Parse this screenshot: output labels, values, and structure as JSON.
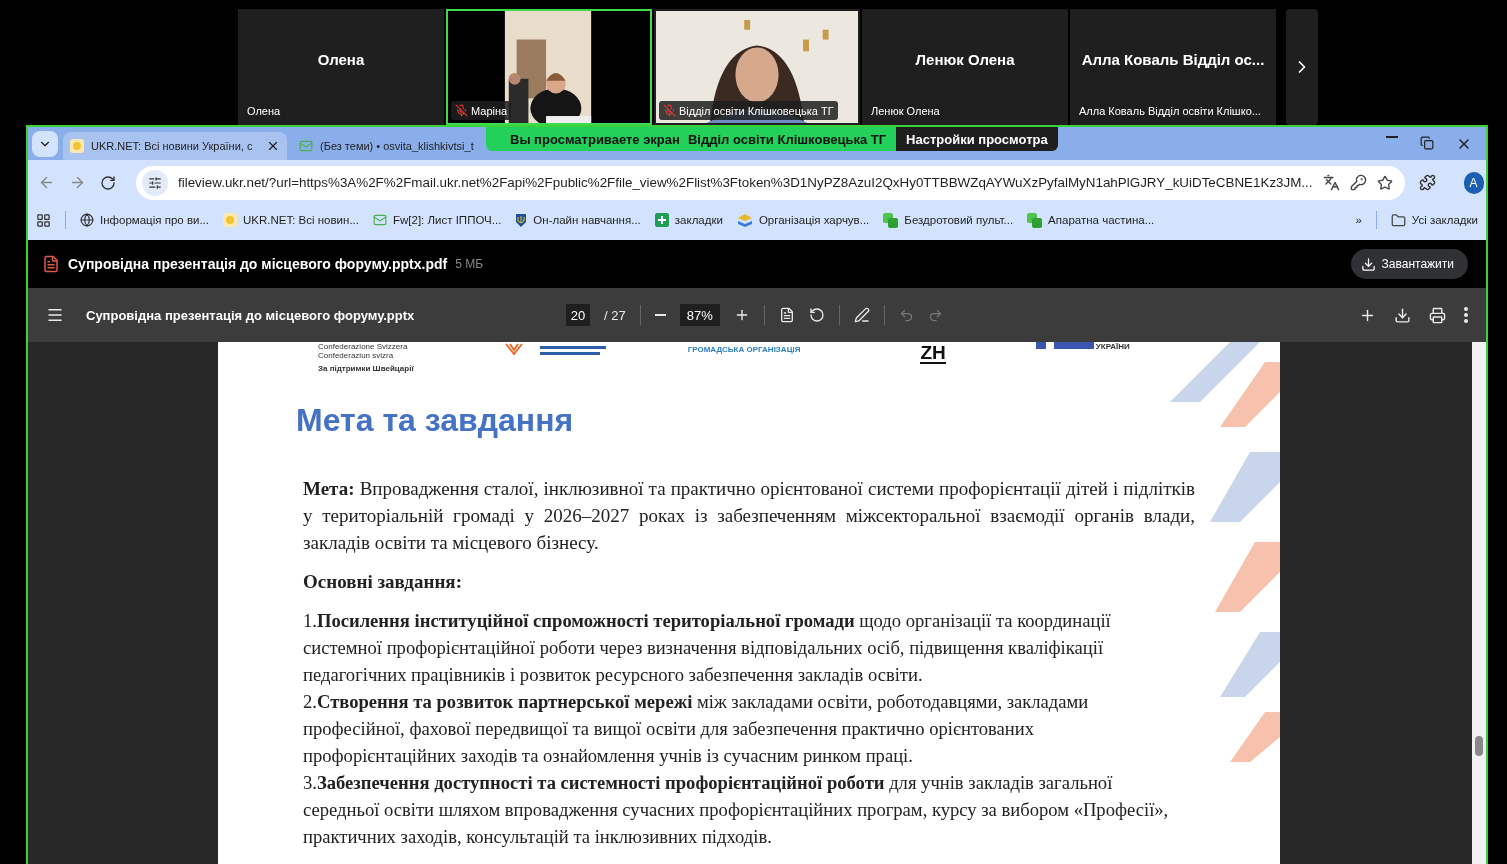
{
  "participants": [
    {
      "kind": "name",
      "name": "Олена",
      "label": "Олена",
      "muted": false,
      "selected": false
    },
    {
      "kind": "video",
      "label": "Маріна",
      "muted": true,
      "selected": true
    },
    {
      "kind": "video",
      "label": "Відділ освіти Клішковецька ТГ",
      "muted": true,
      "selected": false
    },
    {
      "kind": "name",
      "name": "Ленюк Олена",
      "label": "Ленюк Олена",
      "muted": false,
      "selected": false
    },
    {
      "kind": "name",
      "name": "Алла Коваль Відділ ос...",
      "label": "Алла Коваль Відділ освіти Клішко...",
      "muted": false,
      "selected": false
    }
  ],
  "share_banner": {
    "text": "Вы просматриваете экран",
    "presenter": "Відділ освіти Клішковецька ТГ",
    "settings": "Настройки просмотра"
  },
  "tabs": [
    {
      "title": "UKR.NET: Всі новини України, с",
      "selected": false,
      "closable": true
    },
    {
      "title": "(Без теми) • osvita_klishkivtsi_t",
      "selected": false,
      "closable": false
    }
  ],
  "address": "fileview.ukr.net/?url=https%3A%2F%2Fmail.ukr.net%2Fapi%2Fpublic%2Ffile_view%2Flist%3Ftoken%3D1NyPZ8AzuI2QxHy0TTBBWZqAYWuXzPyfalMyN1ahPlGJRY_kUiDTeCBNE1Kz3JM...",
  "profile": "A",
  "bookmarks": [
    "Інформація про ви...",
    "UKR.NET: Всі новин...",
    "Fw[2]: Лист ІППОЧ...",
    "Он-лайн навчання...",
    "закладки",
    "Організація харчув...",
    "Бездротовий пульт...",
    "Апаратна частина..."
  ],
  "bookmarks_more": "»",
  "all_bookmarks": "Усі закладки",
  "file_header": {
    "name": "Супровідна презентація до місцевого форуму.pptx.pdf",
    "size": "5 МБ",
    "download": "Завантажити"
  },
  "pdf_toolbar": {
    "title": "Супровідна презентація до місцевого форуму.pptx",
    "page": "20",
    "pages": "/ 27",
    "zoom": "87%"
  },
  "slide": {
    "logos": {
      "swiss_1": "Confederazione Svizzera",
      "swiss_2": "Confederaziun svizra",
      "swiss_3": "За підтримки Швейцарії",
      "org": "ГРОМАДСЬКА ОРГАНІЗАЦІЯ",
      "zh": "ZH",
      "ukraine": "УКРАЇНИ"
    },
    "title": "Мета та завдання",
    "goal": "**Мета:** Впровадження сталої, інклюзивної та практично орієнтованої системи профорієнтації дітей і підлітків у територіальній громаді у 2026–2027 роках із забезпеченням міжсекторальної взаємодії органів влади, закладів освіти та місцевого бізнесу.",
    "tasks_heading": "Основні завдання:",
    "tasks": [
      "1.**Посилення інституційної спроможності територіальної громади** щодо організації та координації системної профорієнтаційної роботи через визначення відповідальних осіб, підвищення кваліфікації педагогічних працівників і розвиток ресурсного забезпечення закладів освіти.",
      "2.**Створення та розвиток партнерської мережі** між закладами освіти, роботодавцями, закладами професійної, фахової передвищої та вищої освіти для забезпечення практично орієнтованих профорієнтаційних заходів та ознайомлення учнів із сучасним ринком праці.",
      "3.**Забезпечення доступності та системності профорієнтаційної роботи** для учнів закладів загальної середньої освіти шляхом впровадження сучасних профорієнтаційних програм, курсу за вибором «Професії», практичних заходів, консультацій та інклюзивних підходів."
    ]
  }
}
